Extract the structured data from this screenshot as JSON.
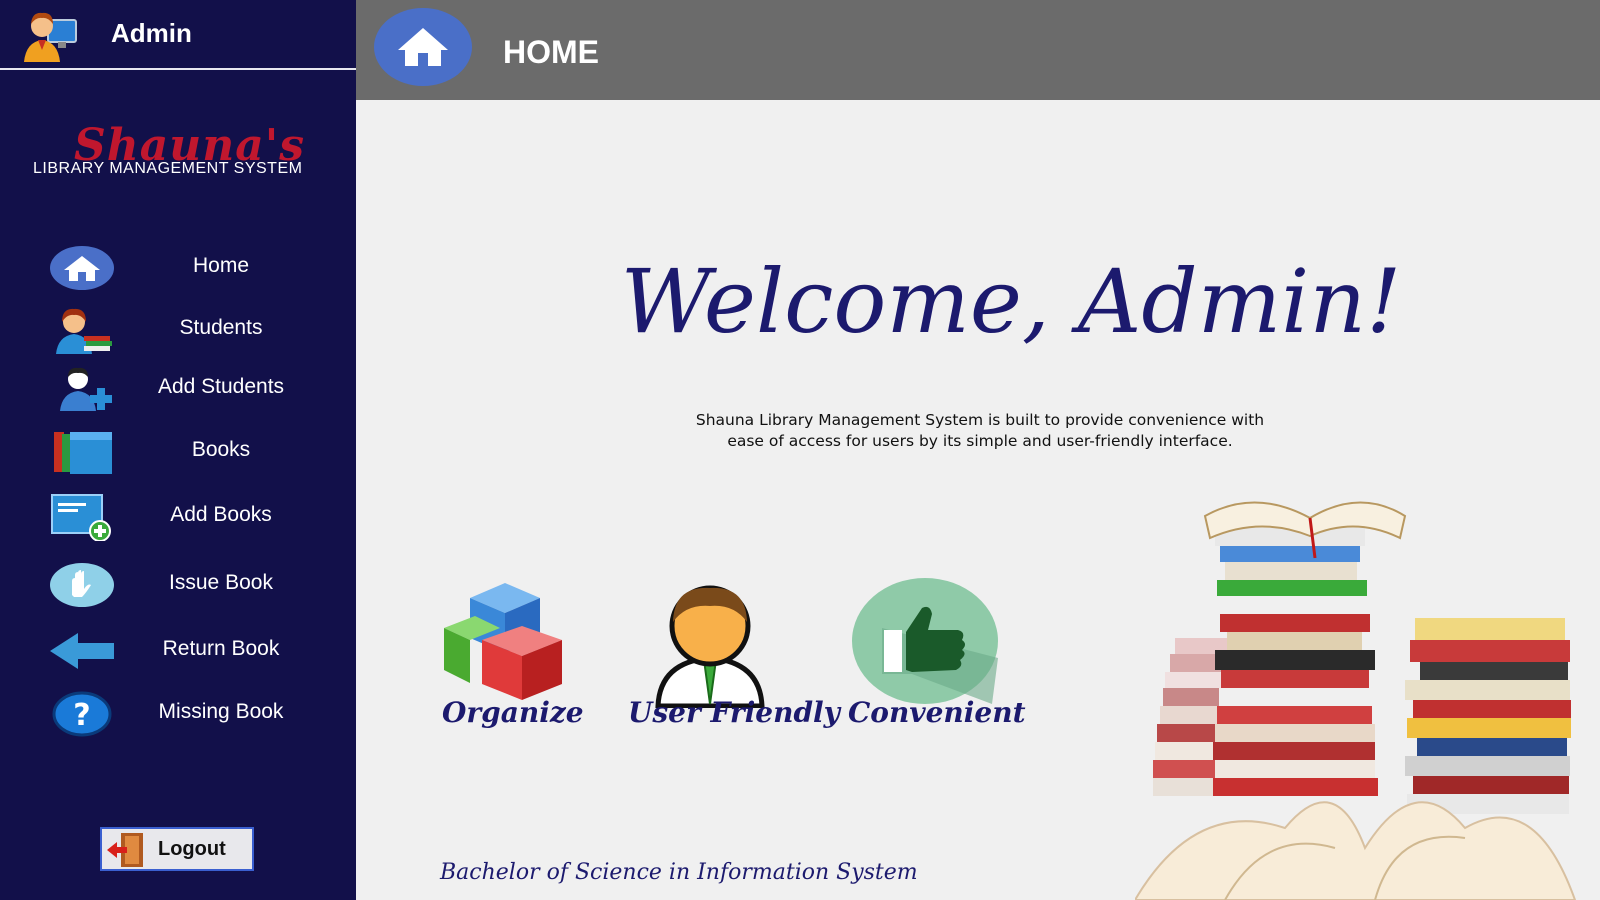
{
  "header": {
    "user_name": "Admin",
    "page_title": "HOME"
  },
  "logo": {
    "script": "Shauna's",
    "subtitle": "LIBRARY MANAGEMENT SYSTEM"
  },
  "sidebar": {
    "items": [
      {
        "label": "Home",
        "icon": "home-icon"
      },
      {
        "label": "Students",
        "icon": "students-icon"
      },
      {
        "label": "Add Students",
        "icon": "add-student-icon"
      },
      {
        "label": "Books",
        "icon": "books-icon"
      },
      {
        "label": "Add Books",
        "icon": "add-books-icon"
      },
      {
        "label": "Issue Book",
        "icon": "hand-icon"
      },
      {
        "label": "Return Book",
        "icon": "arrow-left-icon"
      },
      {
        "label": "Missing Book",
        "icon": "question-icon"
      }
    ],
    "logout_label": "Logout"
  },
  "main": {
    "welcome": "Welcome, Admin!",
    "description_line1": "Shauna Library Management System is built to provide convenience with",
    "description_line2": "ease of access for users by its simple and user-friendly interface.",
    "features": [
      {
        "label": "Organize",
        "icon": "cubes-icon"
      },
      {
        "label": "User Friendly",
        "icon": "user-icon"
      },
      {
        "label": "Convenient",
        "icon": "thumbs-up-icon"
      }
    ],
    "footer": "Bachelor of Science in Information System"
  },
  "colors": {
    "sidebar_bg": "#12104a",
    "topbar_bg": "#6b6b6b",
    "content_bg": "#f0f0f0",
    "accent_text": "#1c1a6e",
    "logo_red": "#c0172e"
  }
}
